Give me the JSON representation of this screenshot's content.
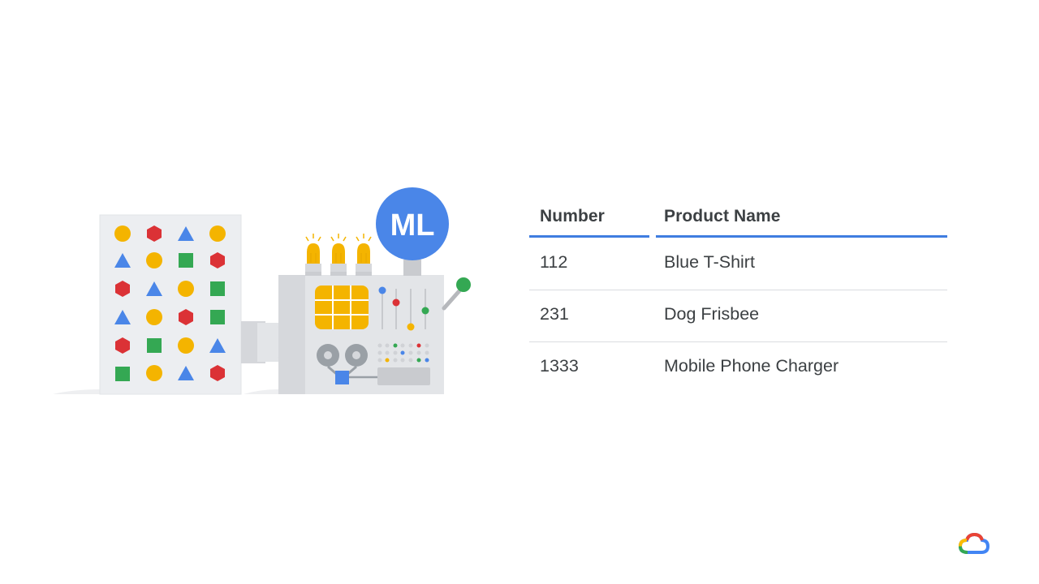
{
  "illustration": {
    "badge_text": "ML",
    "colors": {
      "blue": "#4a86e8",
      "red": "#db3236",
      "green": "#34a853",
      "yellow": "#f4b400",
      "panel": "#eceef1",
      "machine": "#dfe1e5"
    }
  },
  "table": {
    "headers": {
      "number": "Number",
      "product_name": "Product Name"
    },
    "rows": [
      {
        "number": "112",
        "product_name": "Blue T-Shirt"
      },
      {
        "number": "231",
        "product_name": "Dog Frisbee"
      },
      {
        "number": "1333",
        "product_name": "Mobile Phone Charger"
      }
    ],
    "accent_color": "#3f7de0"
  },
  "logo": {
    "name": "google-cloud-logo-icon"
  }
}
